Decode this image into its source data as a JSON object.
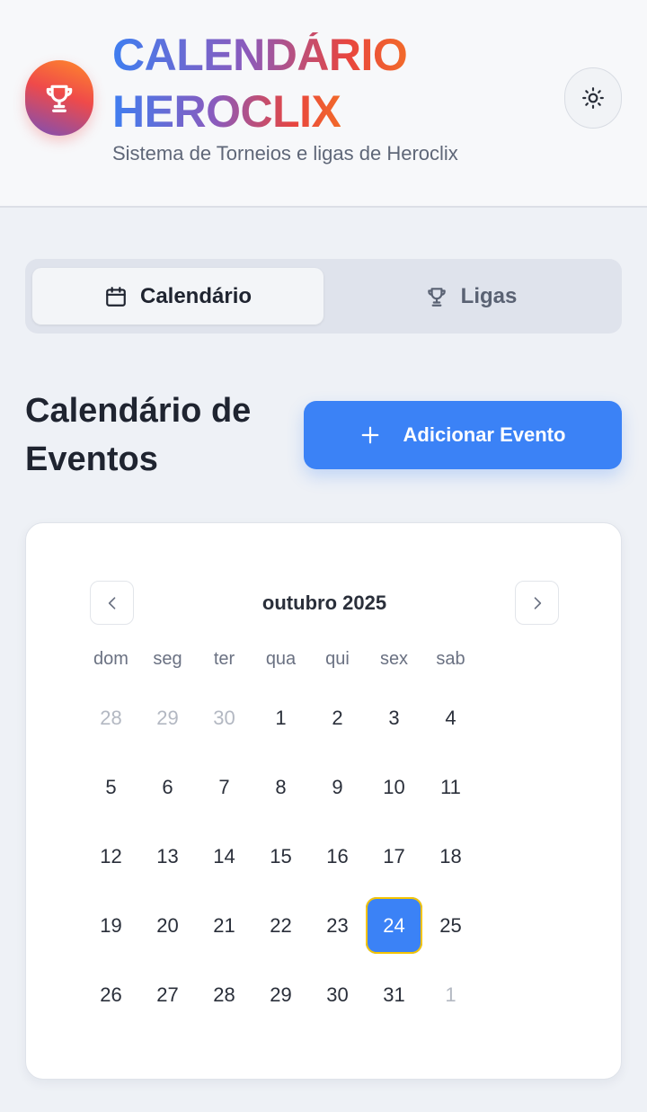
{
  "header": {
    "title_line1": "CALENDÁRIO",
    "title_line2": "HEROCLIX",
    "subtitle": "Sistema de Torneios e ligas de Heroclix",
    "logo_icon": "trophy-icon",
    "theme_toggle_icon": "sun-icon"
  },
  "tabs": [
    {
      "label": "Calendário",
      "icon": "calendar-icon",
      "active": true
    },
    {
      "label": "Ligas",
      "icon": "trophy-icon",
      "active": false
    }
  ],
  "section": {
    "title": "Calendário de Eventos",
    "add_button_label": "Adicionar Evento",
    "add_button_icon": "plus-icon"
  },
  "calendar": {
    "month_label": "outubro 2025",
    "weekdays": [
      "dom",
      "seg",
      "ter",
      "qua",
      "qui",
      "sex",
      "sab"
    ],
    "weeks": [
      [
        {
          "d": "28",
          "muted": true
        },
        {
          "d": "29",
          "muted": true
        },
        {
          "d": "30",
          "muted": true
        },
        {
          "d": "1"
        },
        {
          "d": "2"
        },
        {
          "d": "3"
        },
        {
          "d": "4"
        }
      ],
      [
        {
          "d": "5"
        },
        {
          "d": "6"
        },
        {
          "d": "7"
        },
        {
          "d": "8"
        },
        {
          "d": "9"
        },
        {
          "d": "10"
        },
        {
          "d": "11"
        }
      ],
      [
        {
          "d": "12"
        },
        {
          "d": "13"
        },
        {
          "d": "14"
        },
        {
          "d": "15"
        },
        {
          "d": "16"
        },
        {
          "d": "17"
        },
        {
          "d": "18"
        }
      ],
      [
        {
          "d": "19"
        },
        {
          "d": "20"
        },
        {
          "d": "21"
        },
        {
          "d": "22"
        },
        {
          "d": "23"
        },
        {
          "d": "24",
          "today": true
        },
        {
          "d": "25"
        }
      ],
      [
        {
          "d": "26"
        },
        {
          "d": "27"
        },
        {
          "d": "28"
        },
        {
          "d": "29"
        },
        {
          "d": "30"
        },
        {
          "d": "31"
        },
        {
          "d": "1",
          "muted": true
        }
      ]
    ]
  },
  "colors": {
    "accent": "#3b82f6",
    "today_outline": "#f5c400",
    "title_gradient_start": "#3f7ef0",
    "title_gradient_end": "#f26a2a"
  }
}
